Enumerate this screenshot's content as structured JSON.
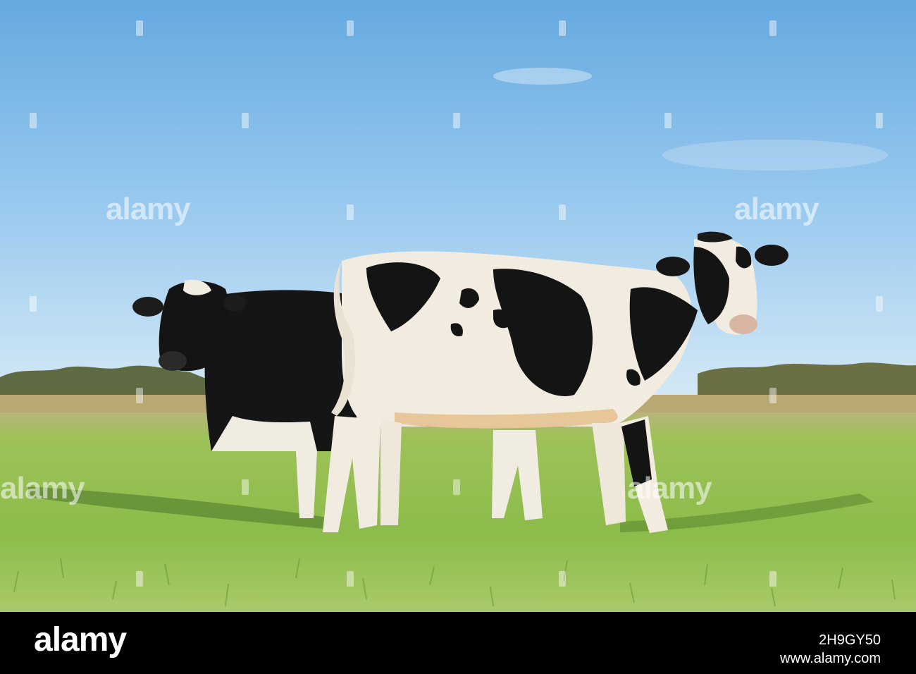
{
  "photo": {
    "colors": {
      "sky_top": "#6fb0e3",
      "sky_bottom": "#cfe6f6",
      "grass": "#8fbf4e",
      "grass_dark": "#5e8f32",
      "treeline": "#5c6a40",
      "cow_black": "#141414",
      "cow_white": "#f2ece0"
    }
  },
  "watermark": {
    "text": "alamy"
  },
  "footer": {
    "logo": "alamy",
    "image_id": "2H9GY50",
    "site": "www.alamy.com"
  }
}
